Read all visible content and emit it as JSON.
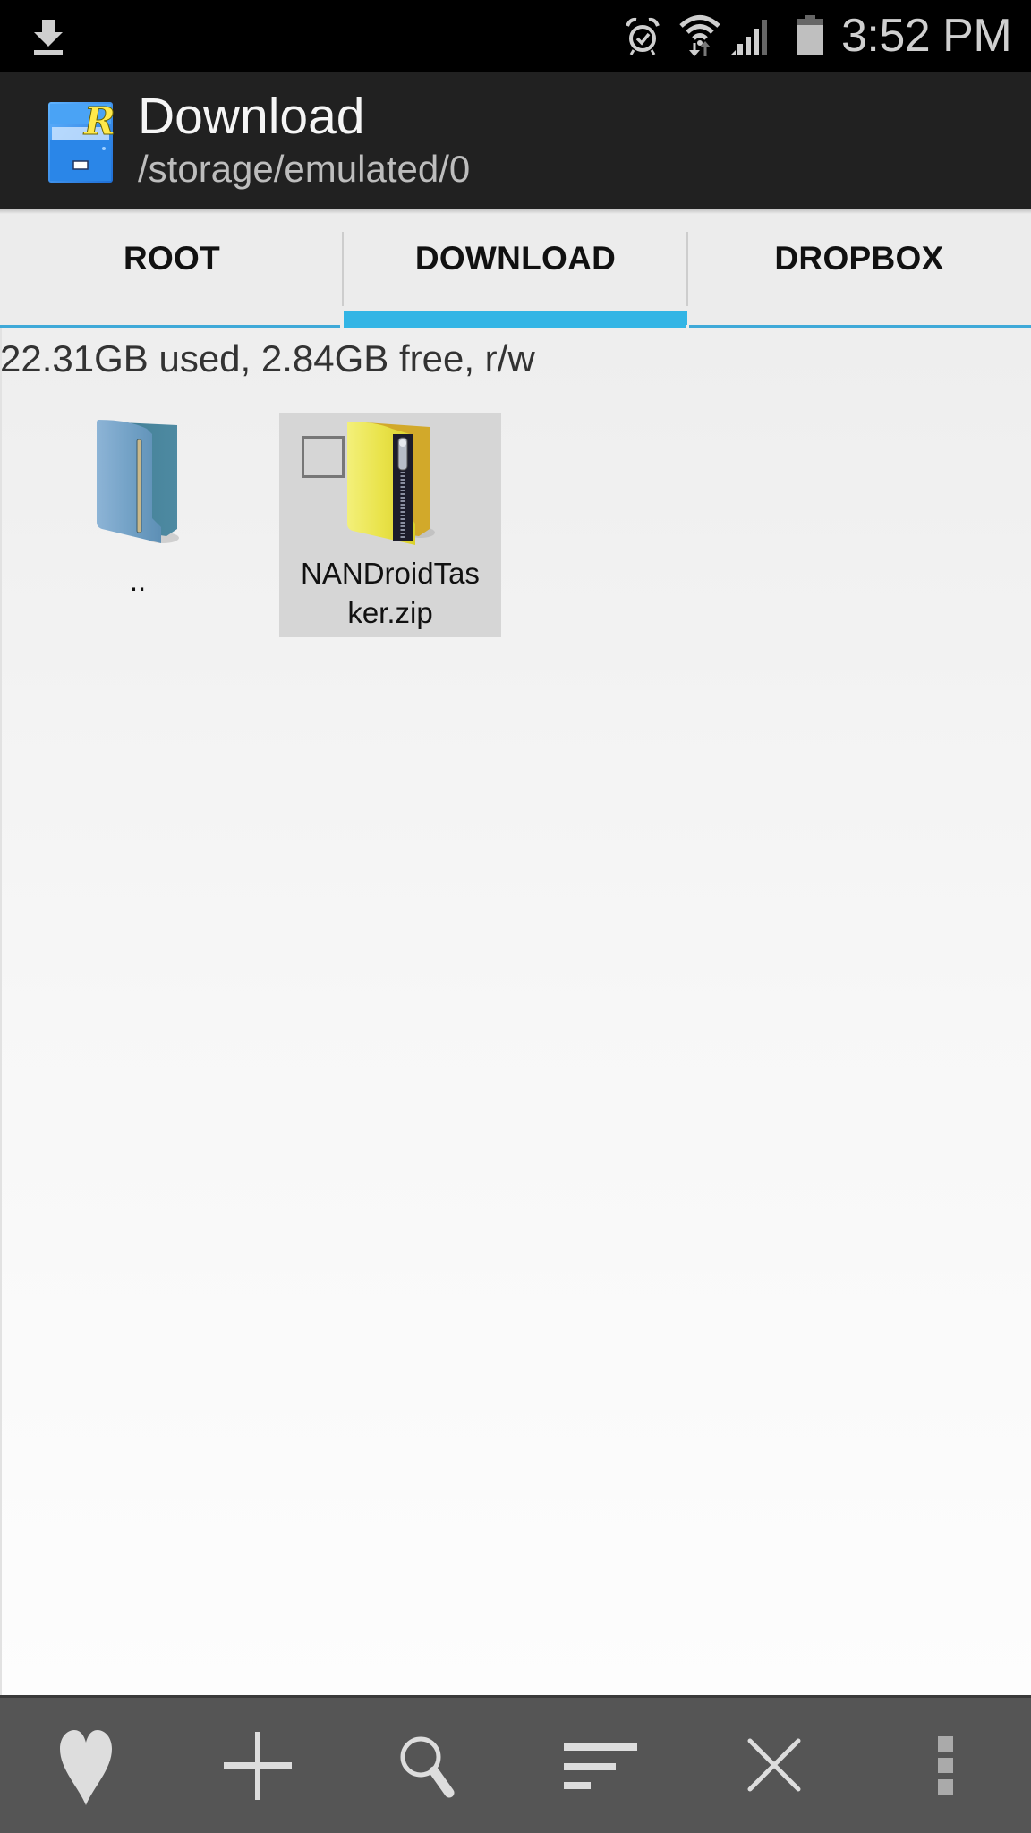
{
  "status_bar": {
    "time": "3:52 PM",
    "icons": [
      "download-notification-icon",
      "alarm-icon",
      "wifi-icon",
      "cell-signal-icon",
      "battery-icon"
    ]
  },
  "app_bar": {
    "app_icon": "root-explorer-icon",
    "title": "Download",
    "subtitle": "/storage/emulated/0"
  },
  "tabs": [
    {
      "label": "ROOT",
      "selected": false
    },
    {
      "label": "DOWNLOAD",
      "selected": true
    },
    {
      "label": "DROPBOX",
      "selected": false
    }
  ],
  "storage_info": "22.31GB used, 2.84GB free, r/w",
  "files": [
    {
      "name": "..",
      "type": "parent-folder",
      "icon": "folder-icon",
      "selected": false
    },
    {
      "name": "NANDroidTasker.zip",
      "label_lines": [
        "NANDroidTas",
        "ker.zip"
      ],
      "type": "zip",
      "icon": "zip-folder-icon",
      "selected": true,
      "checked": false
    }
  ],
  "toolbar": [
    {
      "name": "favorites",
      "icon": "heart-icon"
    },
    {
      "name": "new",
      "icon": "plus-icon"
    },
    {
      "name": "search",
      "icon": "search-icon"
    },
    {
      "name": "sort",
      "icon": "sort-icon"
    },
    {
      "name": "close",
      "icon": "close-icon"
    },
    {
      "name": "more",
      "icon": "more-vert-icon"
    }
  ],
  "colors": {
    "accent": "#33b5e5",
    "app_bar": "#212121",
    "toolbar": "#555555",
    "selection": "#d6d6d6"
  }
}
